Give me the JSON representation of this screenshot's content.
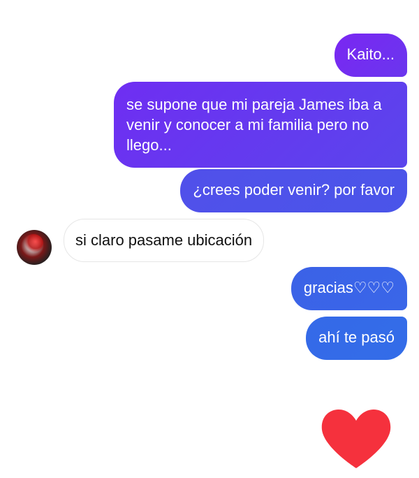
{
  "messages": [
    {
      "text": "Kaito...",
      "side": "out"
    },
    {
      "text": "se supone que mi pareja James iba a venir y conocer a mi familia pero no llego...",
      "side": "out"
    },
    {
      "text": "¿crees poder venir? por favor",
      "side": "out"
    },
    {
      "text": "si claro pasame ubicación",
      "side": "in"
    },
    {
      "text": "gracias♡♡♡",
      "side": "out"
    },
    {
      "text": "ahí te pasó",
      "side": "out"
    }
  ],
  "reaction": {
    "icon": "heart-icon",
    "color": "#f5313d"
  },
  "colors": {
    "outgoing_top": "#7a27f2",
    "outgoing_bottom": "#336de8",
    "incoming_bg": "#ffffff",
    "incoming_text": "#111111"
  }
}
